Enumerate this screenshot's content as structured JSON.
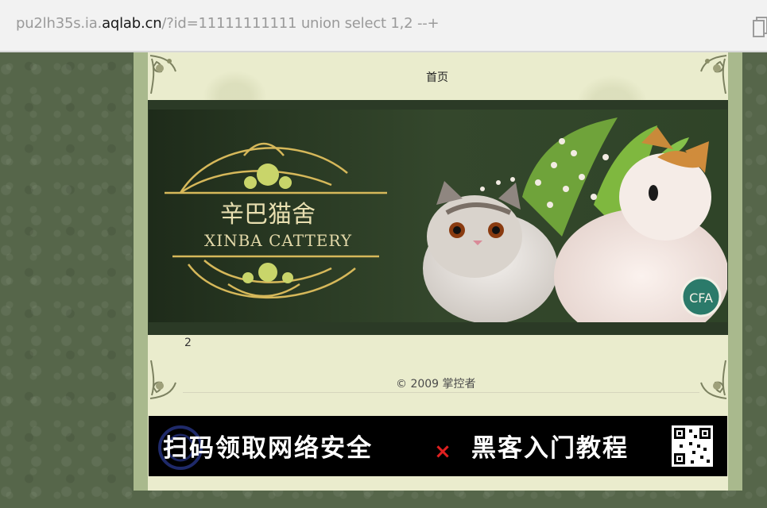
{
  "browser": {
    "url_prefix": "pu2lh35s.ia.",
    "url_host": "aqlab.cn",
    "url_suffix": "/?id=11111111111 union select 1,2 --+"
  },
  "nav": {
    "home": "首页"
  },
  "banner": {
    "title_cn": "辛巴猫舍",
    "title_en": "XINBA CATTERY",
    "badge": "CFA"
  },
  "result": {
    "value": "2"
  },
  "footer": {
    "copyright": "© 2009 掌控者"
  },
  "ad": {
    "text_left": "扫码领取网络安全",
    "cross": "×",
    "text_right": "黑客入门教程"
  },
  "colors": {
    "background": "#56664a",
    "paper": "#eaeccd",
    "banner": "#2b3a26",
    "accent_red": "#e02020"
  }
}
